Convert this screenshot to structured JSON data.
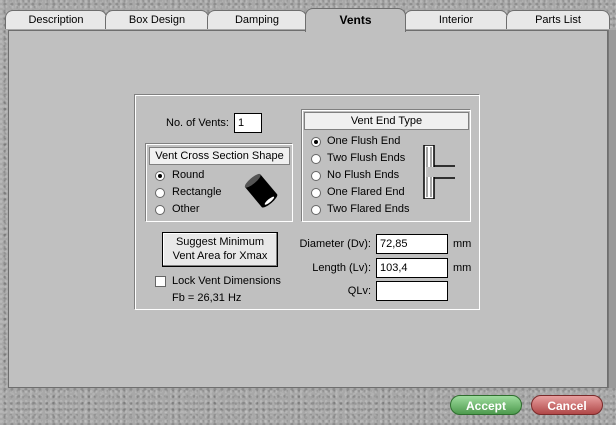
{
  "tabs": [
    {
      "label": "Description"
    },
    {
      "label": "Box Design"
    },
    {
      "label": "Damping"
    },
    {
      "label": "Vents"
    },
    {
      "label": "Interior"
    },
    {
      "label": "Parts List"
    }
  ],
  "active_tab": "Vents",
  "vents": {
    "num_label": "No. of Vents:",
    "num_value": "1"
  },
  "cross_section": {
    "title": "Vent Cross Section Shape",
    "options": [
      "Round",
      "Rectangle",
      "Other"
    ],
    "selected": "Round"
  },
  "end_type": {
    "title": "Vent End Type",
    "options": [
      "One Flush End",
      "Two Flush Ends",
      "No Flush Ends",
      "One Flared End",
      "Two Flared Ends"
    ],
    "selected": "One Flush End"
  },
  "suggest_button": {
    "line1": "Suggest Minimum",
    "line2": "Vent Area for Xmax"
  },
  "lock": {
    "label": "Lock Vent Dimensions",
    "checked": false
  },
  "fb_text": "Fb = 26,31 Hz",
  "dimensions": {
    "diameter_label": "Diameter (Dv):",
    "diameter_value": "72,85",
    "diameter_unit": "mm",
    "length_label": "Length (Lv):",
    "length_value": "103,4",
    "length_unit": "mm",
    "qlv_label": "QLv:",
    "qlv_value": ""
  },
  "footer": {
    "accept": "Accept",
    "cancel": "Cancel"
  },
  "colors": {
    "accept": "#5aa85a",
    "cancel": "#c06060",
    "panel": "#c0c0c0"
  }
}
